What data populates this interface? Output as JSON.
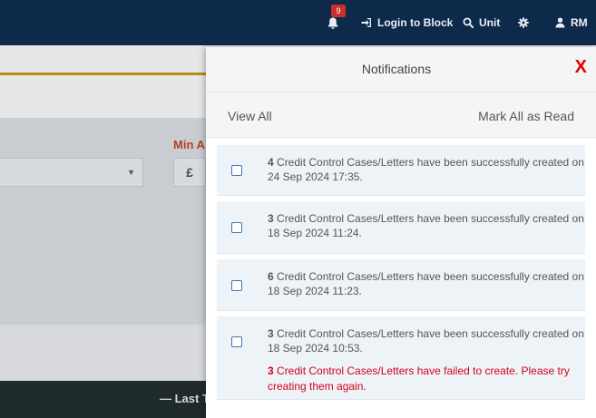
{
  "topbar": {
    "notification_count": "9",
    "login_label": "Login to Block",
    "unit_label": "Unit",
    "user_initials": "RM"
  },
  "background": {
    "min_label": "Min A",
    "currency_symbol": "£",
    "footer_text": "— Last T"
  },
  "panel": {
    "title": "Notifications",
    "close_label": "X",
    "view_all": "View All",
    "mark_all": "Mark All as Read",
    "items": [
      {
        "count": "4",
        "text": " Credit Control Cases/Letters have been successfully created on 24 Sep 2024 17:35."
      },
      {
        "count": "3",
        "text": " Credit Control Cases/Letters have been successfully created on 18 Sep 2024 11:24."
      },
      {
        "count": "6",
        "text": " Credit Control Cases/Letters have been successfully created on 18 Sep 2024 11:23."
      },
      {
        "count": "3",
        "text": " Credit Control Cases/Letters have been successfully created on 18 Sep 2024 10:53.",
        "error_count": "3",
        "error_text": " Credit Control Cases/Letters have failed to create. Please try creating them again."
      }
    ]
  },
  "colors": {
    "nav_bg": "#0d2a4a",
    "badge": "#c9302c",
    "close": "#e50000",
    "error": "#d0021b",
    "checkbox": "#3b78b5"
  }
}
